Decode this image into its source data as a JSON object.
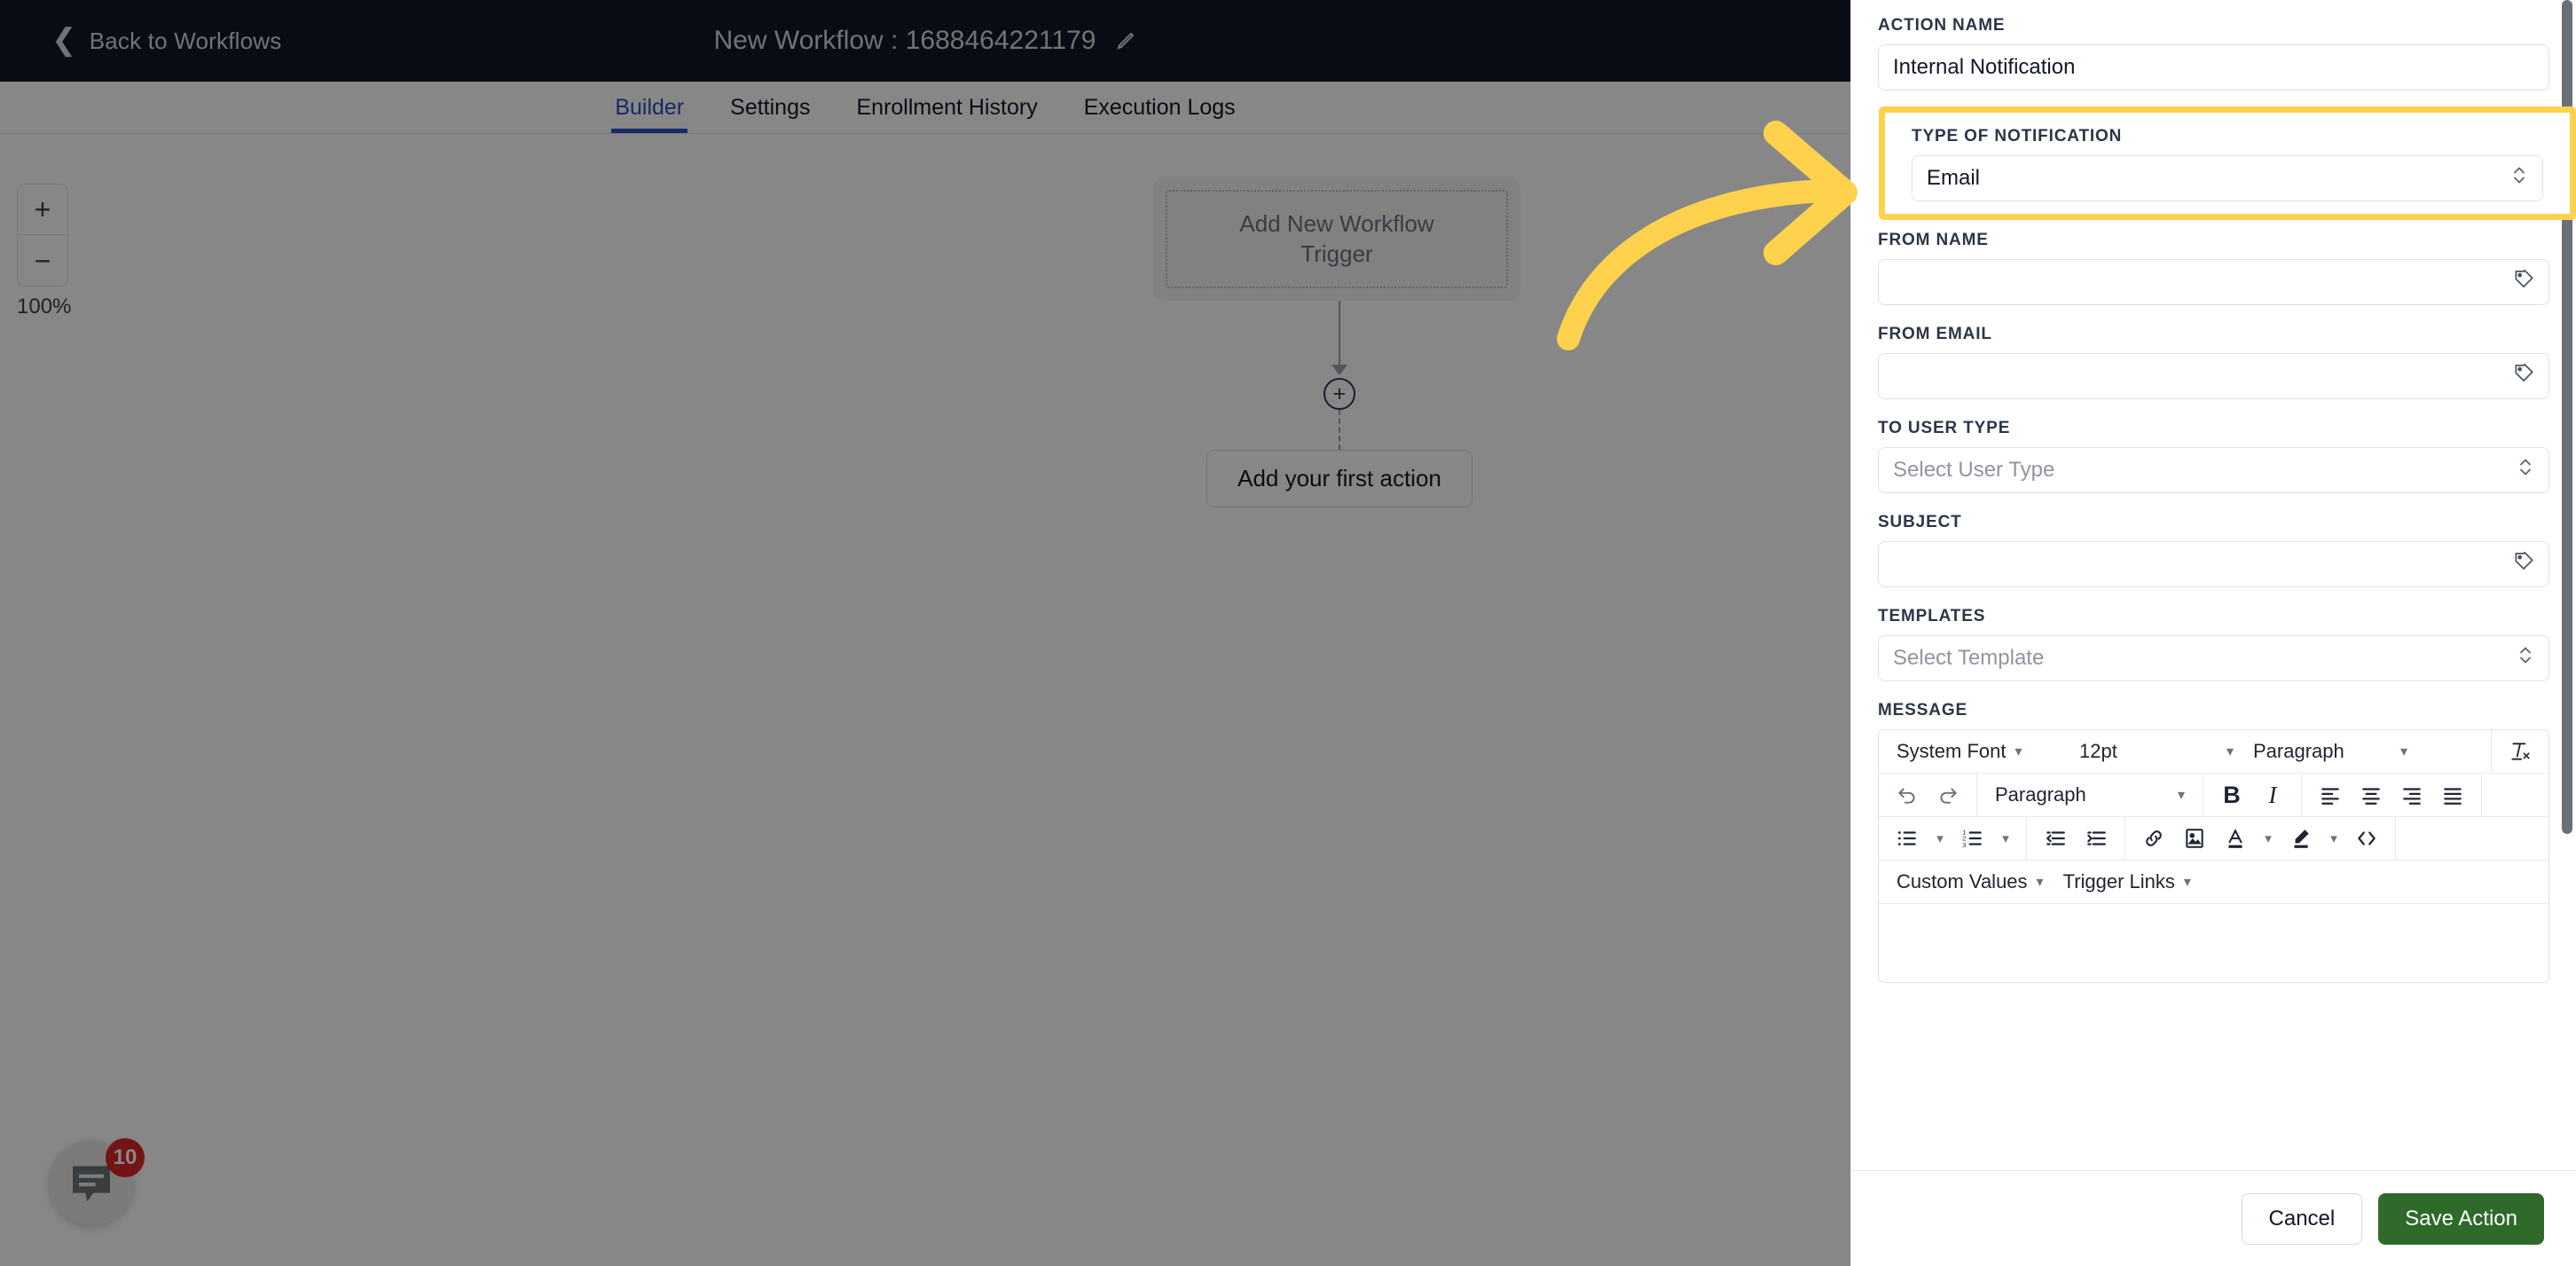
{
  "topbar": {
    "back_label": "Back to Workflows",
    "back_icon": "chevron-left-icon",
    "workflow_title": "New Workflow : 1688464221179",
    "edit_icon": "pencil-icon"
  },
  "tabs": [
    {
      "label": "Builder",
      "active": true
    },
    {
      "label": "Settings",
      "active": false
    },
    {
      "label": "Enrollment History",
      "active": false
    },
    {
      "label": "Execution Logs",
      "active": false
    }
  ],
  "canvas": {
    "zoom_in_label": "+",
    "zoom_out_label": "−",
    "zoom_level": "100%",
    "trigger_placeholder": "Add New Workflow Trigger",
    "plus_node_label": "+",
    "first_action_label": "Add your first action"
  },
  "chat_widget": {
    "icon": "chat-bubble-icon",
    "unread_count": "10"
  },
  "annotation": {
    "arrow_color": "#FFD24D",
    "highlight_border_color": "#FFD24D"
  },
  "panel": {
    "action_name": {
      "label": "ACTION NAME",
      "value": "Internal Notification",
      "placeholder": ""
    },
    "type_of_notification": {
      "label": "TYPE OF NOTIFICATION",
      "value": "Email",
      "icon": "chevron-up-down-icon"
    },
    "from_name": {
      "label": "FROM NAME",
      "value": "",
      "placeholder": "",
      "icon": "tag-icon"
    },
    "from_email": {
      "label": "FROM EMAIL",
      "value": "",
      "placeholder": "",
      "icon": "tag-icon"
    },
    "to_user_type": {
      "label": "TO USER TYPE",
      "value": "Select User Type",
      "icon": "chevron-up-down-icon"
    },
    "subject": {
      "label": "SUBJECT",
      "value": "",
      "placeholder": "",
      "icon": "tag-icon"
    },
    "templates": {
      "label": "TEMPLATES",
      "value": "Select Template",
      "icon": "chevron-up-down-icon"
    },
    "message": {
      "label": "MESSAGE",
      "toolbar_row1": {
        "font_family": "System Font",
        "font_size": "12pt",
        "block_format": "Paragraph",
        "clear_format_icon": "clear-formatting-icon"
      },
      "toolbar_row2": {
        "undo_icon": "undo-icon",
        "redo_icon": "redo-icon",
        "block_format": "Paragraph",
        "bold_label": "B",
        "italic_label": "I",
        "align_left_icon": "align-left-icon",
        "align_center_icon": "align-center-icon",
        "align_right_icon": "align-right-icon",
        "align_justify_icon": "align-justify-icon"
      },
      "toolbar_row3": {
        "bullet_list_icon": "bullet-list-icon",
        "numbered_list_icon": "numbered-list-icon",
        "outdent_icon": "outdent-icon",
        "indent_icon": "indent-icon",
        "link_icon": "link-icon",
        "image_icon": "image-icon",
        "text_color_icon": "text-color-icon",
        "highlight_color_icon": "highlight-color-icon",
        "source_code_icon": "source-code-icon"
      },
      "toolbar_row4": {
        "custom_values": "Custom Values",
        "trigger_links": "Trigger Links"
      },
      "body_value": ""
    },
    "footer": {
      "cancel_label": "Cancel",
      "save_label": "Save Action",
      "save_color": "#2f6a2b"
    }
  }
}
